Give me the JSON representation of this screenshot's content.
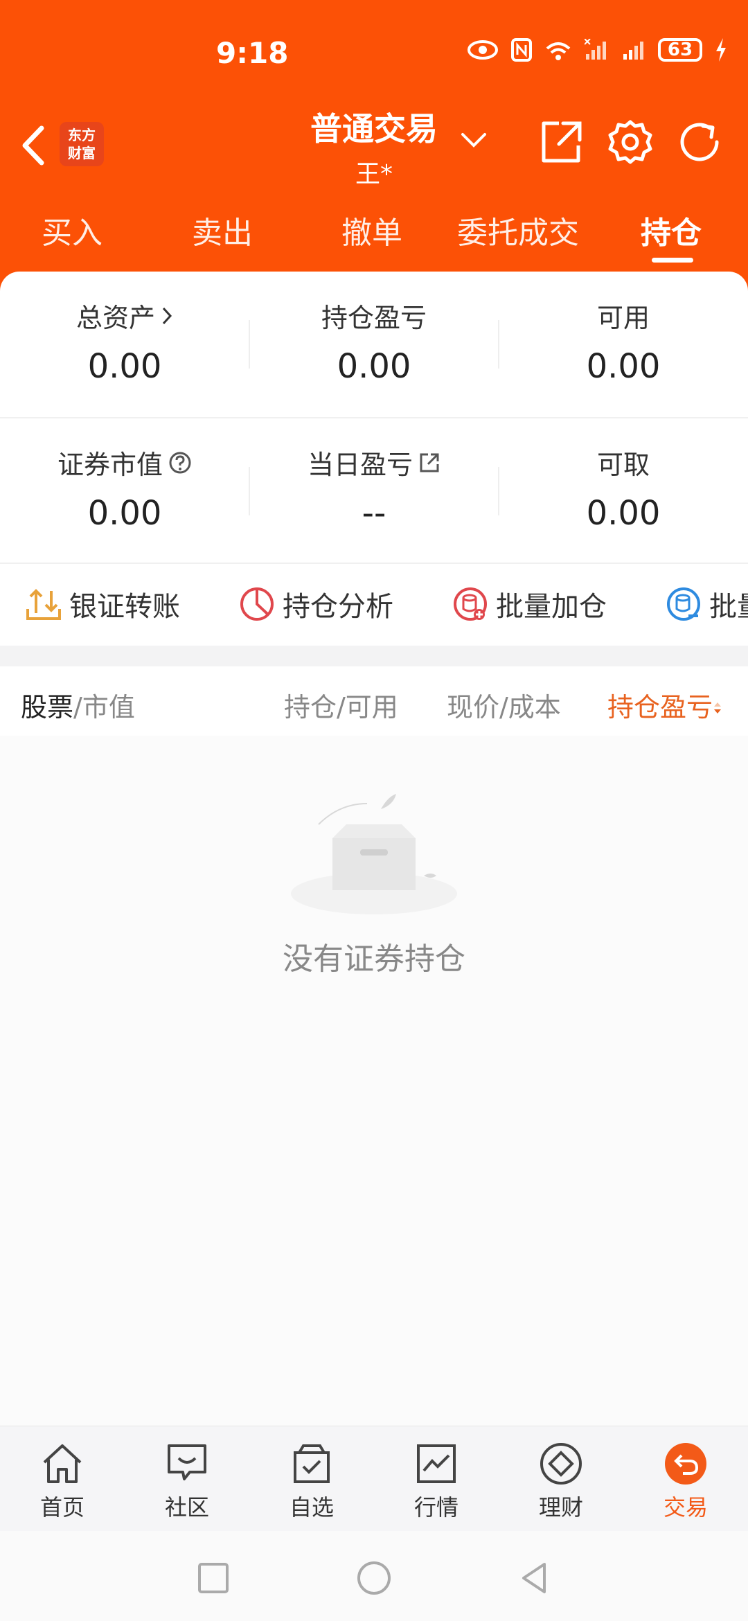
{
  "status": {
    "time": "9:18",
    "battery": "63",
    "network": "4G"
  },
  "header": {
    "logo_line1": "东方",
    "logo_line2": "财富",
    "title": "普通交易",
    "account": "王*"
  },
  "tabs": [
    {
      "label": "买入"
    },
    {
      "label": "卖出"
    },
    {
      "label": "撤单"
    },
    {
      "label": "委托成交"
    },
    {
      "label": "持仓"
    }
  ],
  "summary": {
    "total_assets_label": "总资产",
    "total_assets_value": "0.00",
    "position_pnl_label": "持仓盈亏",
    "position_pnl_value": "0.00",
    "available_label": "可用",
    "available_value": "0.00",
    "market_value_label": "证券市值",
    "market_value_value": "0.00",
    "daily_pnl_label": "当日盈亏",
    "daily_pnl_value": "--",
    "withdrawable_label": "可取",
    "withdrawable_value": "0.00"
  },
  "quick_actions": [
    {
      "label": "银证转账",
      "icon": "bank-transfer-icon"
    },
    {
      "label": "持仓分析",
      "icon": "pie-chart-icon"
    },
    {
      "label": "批量加仓",
      "icon": "batch-add-icon"
    },
    {
      "label": "批量",
      "icon": "batch-reduce-icon"
    }
  ],
  "list_header": {
    "stock": "股票",
    "market_value": "/市值",
    "holding": "持仓/可用",
    "price": "现价/成本",
    "pnl": "持仓盈亏"
  },
  "empty_message": "没有证券持仓",
  "bottom_nav": [
    {
      "label": "首页",
      "icon": "home-icon"
    },
    {
      "label": "社区",
      "icon": "chat-icon"
    },
    {
      "label": "自选",
      "icon": "bag-check-icon"
    },
    {
      "label": "行情",
      "icon": "market-chart-icon"
    },
    {
      "label": "理财",
      "icon": "diamond-icon"
    },
    {
      "label": "交易",
      "icon": "trade-return-icon"
    }
  ],
  "colors": {
    "brand": "#fc5106",
    "active_nav": "#f35a18"
  }
}
